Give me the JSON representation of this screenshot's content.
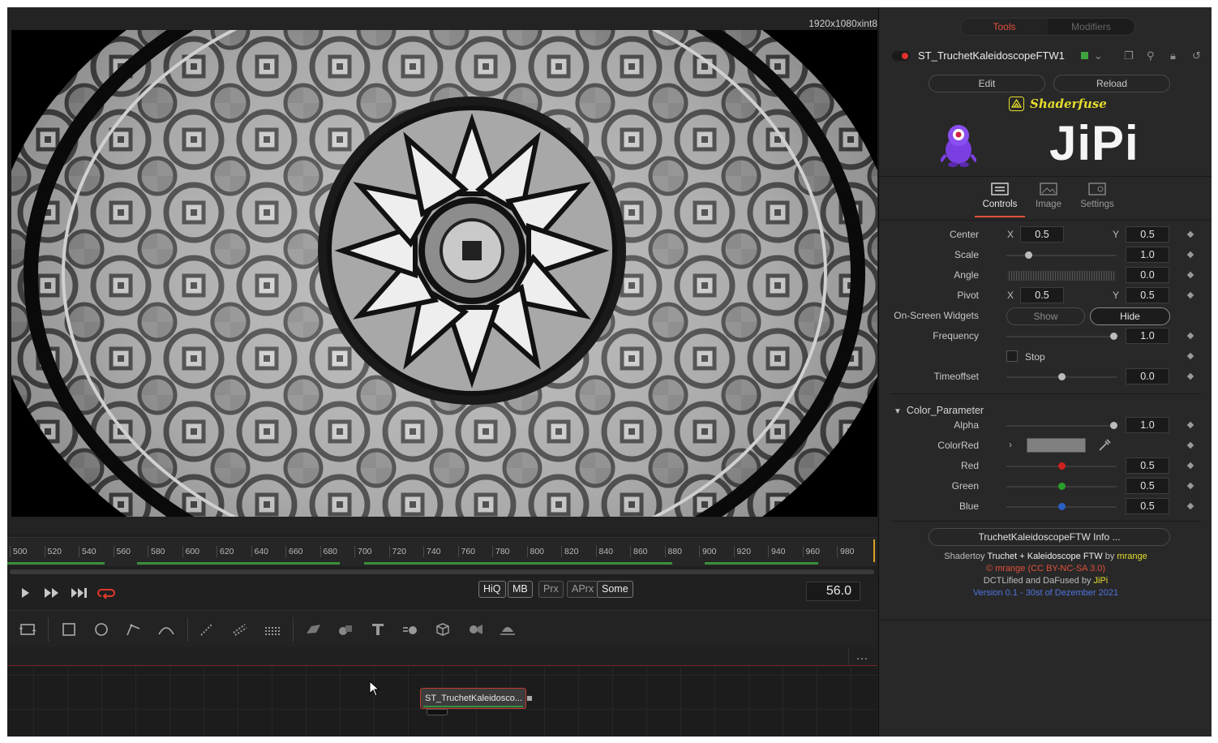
{
  "viewer": {
    "resolution": "1920x1080xint8"
  },
  "ruler": {
    "ticks": [
      "500",
      "520",
      "540",
      "560",
      "580",
      "600",
      "620",
      "640",
      "660",
      "680",
      "700",
      "720",
      "740",
      "760",
      "780",
      "800",
      "820",
      "840",
      "860",
      "880",
      "900",
      "920",
      "940",
      "960",
      "980"
    ]
  },
  "transport": {
    "quality_buttons": [
      {
        "label": "HiQ",
        "active": true
      },
      {
        "label": "MB",
        "active": true
      },
      {
        "label": "Prx",
        "active": false
      },
      {
        "label": "APrx",
        "active": false
      },
      {
        "label": "Some",
        "active": true
      }
    ],
    "current_frame": "56.0"
  },
  "toolbar": {
    "tools": [
      "background-icon",
      "rectangle-mask-icon",
      "ellipse-mask-icon",
      "polygon-mask-icon",
      "bspline-mask-icon",
      "particle-emitter-icon",
      "particle-render-icon",
      "particle-merge-icon",
      "image-plane-3d-icon",
      "shape-3d-icon",
      "text-3d-icon",
      "merge-3d-icon",
      "renderer-3d-icon",
      "camera-3d-icon",
      "spotlight-3d-icon"
    ]
  },
  "node_editor": {
    "menu": "...",
    "node_label": "ST_TruchetKaleidosco..."
  },
  "inspector": {
    "tabs": [
      {
        "label": "Tools",
        "active": true
      },
      {
        "label": "Modifiers",
        "active": false
      }
    ],
    "tool_name": "ST_TruchetKaleidoscopeFTW1",
    "edit_label": "Edit",
    "reload_label": "Reload",
    "brand": "Shaderfuse",
    "logo_text": "JiPi",
    "panel_tabs": [
      {
        "label": "Controls",
        "active": true
      },
      {
        "label": "Image",
        "active": false
      },
      {
        "label": "Settings",
        "active": false
      }
    ],
    "controls": {
      "center": {
        "label": "Center",
        "x_label": "X",
        "x": "0.5",
        "y_label": "Y",
        "y": "0.5"
      },
      "scale": {
        "label": "Scale",
        "value": "1.0",
        "fraction": 0.2
      },
      "angle": {
        "label": "Angle",
        "value": "0.0"
      },
      "pivot": {
        "label": "Pivot",
        "x_label": "X",
        "x": "0.5",
        "y_label": "Y",
        "y": "0.5"
      },
      "widgets": {
        "label": "On-Screen Widgets",
        "show": "Show",
        "hide": "Hide",
        "selected": "Hide"
      },
      "frequency": {
        "label": "Frequency",
        "value": "1.0",
        "fraction": 0.97
      },
      "stop": {
        "label": "Stop",
        "checked": false
      },
      "timeoffset": {
        "label": "Timeoffset",
        "value": "0.0",
        "fraction": 0.5
      }
    },
    "color_section": {
      "title": "Color_Parameter",
      "alpha": {
        "label": "Alpha",
        "value": "1.0",
        "fraction": 0.97
      },
      "colorred": {
        "label": "ColorRed",
        "swatch": "#808080"
      },
      "red": {
        "label": "Red",
        "value": "0.5",
        "fraction": 0.5,
        "color": "#d02020"
      },
      "green": {
        "label": "Green",
        "value": "0.5",
        "fraction": 0.5,
        "color": "#2aa02a"
      },
      "blue": {
        "label": "Blue",
        "value": "0.5",
        "fraction": 0.5,
        "color": "#2a5fc4"
      }
    },
    "info_button": "TruchetKaleidoscopeFTW Info ...",
    "credits": {
      "line1_prefix": "Shadertoy ",
      "line1_title": "Truchet + Kaleidoscope FTW",
      "line1_by": " by ",
      "line1_author": "mrange",
      "line2": "© mrange (CC BY-NC-SA 3.0)",
      "line3_prefix": "DCTLified and DaFused by ",
      "line3_author": "JiPi",
      "line4": "Version 0.1 - 30st of Dezember 2021"
    },
    "colors": {
      "accent": "#e2503d",
      "author": "#e6dd2e",
      "license": "#e2503d",
      "version": "#4f76e0"
    }
  }
}
